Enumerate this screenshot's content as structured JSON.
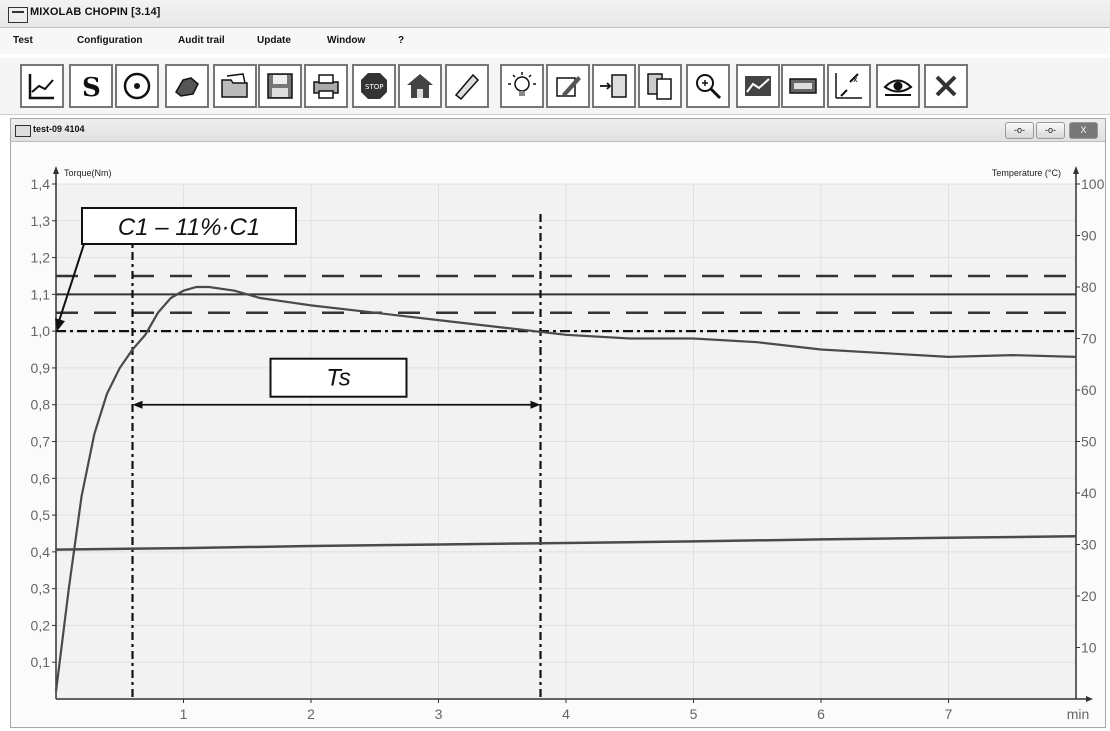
{
  "app": {
    "title": "MIXOLAB CHOPIN [3.14]"
  },
  "menu": [
    "Test",
    "Configuration",
    "Audit trail",
    "Update",
    "Window",
    "?"
  ],
  "toolbar": [
    "graph-icon",
    "s-letter-icon",
    "circle-target-icon",
    "hand-icon",
    "open-folder-icon",
    "save-disk-icon",
    "print-icon",
    "stop-icon",
    "home-icon",
    "ruler-icon",
    "lightbulb-icon",
    "edit-curve-icon",
    "export-icon",
    "copy-icon",
    "zoom-icon",
    "chart-icon",
    "display-icon",
    "scale-icon",
    "eye-icon",
    "close-x-icon"
  ],
  "window": {
    "title": "test-09 4104",
    "controls": [
      "-o-",
      "-o-",
      "X"
    ]
  },
  "chart_data": {
    "type": "line",
    "ylabel_left": "Torque(Nm)",
    "ylabel_right": "Temperature (°C)",
    "xunit": "min",
    "xlim": [
      0,
      8
    ],
    "ylim_left": [
      0,
      1.4
    ],
    "ylim_right": [
      0,
      100
    ],
    "x_ticks": [
      "1",
      "2",
      "3",
      "4",
      "5",
      "6",
      "7",
      "min"
    ],
    "y_ticks_left": [
      "0,1",
      "0,2",
      "0,3",
      "0,4",
      "0,5",
      "0,6",
      "0,7",
      "0,8",
      "0,9",
      "1,0",
      "1,1",
      "1,2",
      "1,3",
      "1,4"
    ],
    "y_ticks_right": [
      "10",
      "20",
      "30",
      "40",
      "50",
      "60",
      "70",
      "80",
      "90",
      "100"
    ],
    "series": [
      {
        "x": [
          0,
          0.1,
          0.2,
          0.3,
          0.4,
          0.5,
          0.6,
          0.7,
          0.8,
          0.9,
          1.0,
          1.1,
          1.2,
          1.4,
          1.6,
          1.8,
          2.0,
          2.5,
          3.0,
          3.5,
          4.0,
          4.5,
          5.0,
          5.5,
          6.0,
          6.5,
          7.0,
          7.5,
          8.0
        ],
        "values": [
          0.02,
          0.3,
          0.55,
          0.72,
          0.83,
          0.9,
          0.95,
          0.99,
          1.05,
          1.09,
          1.11,
          1.12,
          1.12,
          1.11,
          1.09,
          1.08,
          1.07,
          1.05,
          1.03,
          1.01,
          0.99,
          0.98,
          0.98,
          0.97,
          0.95,
          0.94,
          0.93,
          0.935,
          0.93
        ]
      },
      {
        "x": [
          0,
          1,
          2,
          3,
          4,
          5,
          6,
          7,
          8
        ],
        "values": [
          29,
          29.3,
          29.7,
          30,
          30.3,
          30.6,
          31,
          31.3,
          31.6
        ]
      }
    ],
    "reference_lines": {
      "solid_h": 1.1,
      "dashed_h": [
        1.15,
        1.05
      ],
      "dashdot_h": 1.0,
      "dashdot_v": [
        0.6,
        3.8
      ]
    },
    "annotations": {
      "c1_label": "C1 – 11%·C1",
      "ts_label": "Ts"
    }
  }
}
